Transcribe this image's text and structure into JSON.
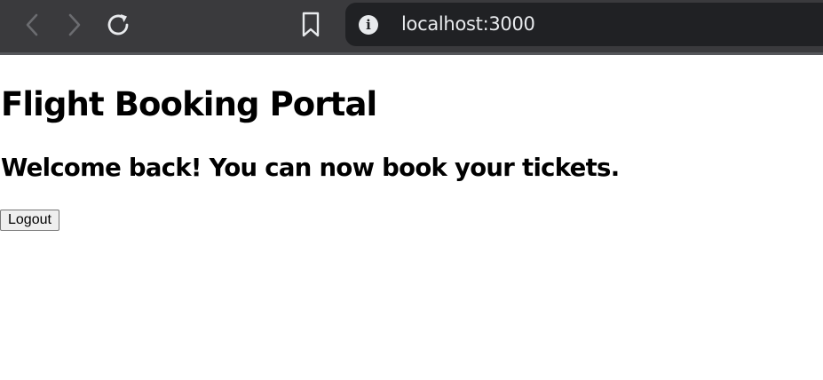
{
  "browser": {
    "url": "localhost:3000",
    "icons": {
      "back": "chevron-left-icon",
      "forward": "chevron-right-icon",
      "reload": "reload-icon",
      "bookmark": "bookmark-icon",
      "site_info": "info-icon"
    },
    "info_glyph": "i",
    "colors": {
      "toolbar_bg": "#3a3a3d",
      "address_bg": "#202124",
      "address_text": "#e8eaed"
    }
  },
  "page": {
    "title": "Flight Booking Portal",
    "welcome_message": "Welcome back! You can now book your tickets.",
    "logout_label": "Logout"
  }
}
